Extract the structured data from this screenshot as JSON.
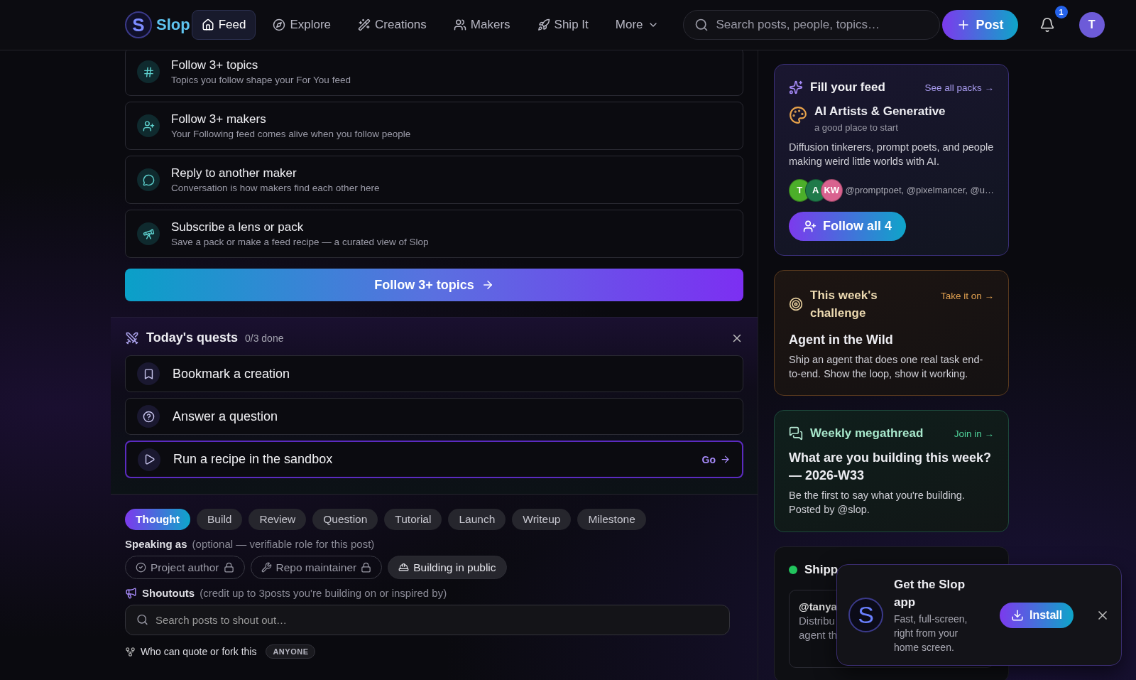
{
  "nav": {
    "logo_letter": "S",
    "logo": "Slop",
    "tabs": [
      {
        "label": "Feed",
        "selected": true
      },
      {
        "label": "Explore",
        "selected": false
      },
      {
        "label": "Creations",
        "selected": false
      },
      {
        "label": "Makers",
        "selected": false
      },
      {
        "label": "Ship It",
        "selected": false
      }
    ],
    "more": "More",
    "search": {
      "placeholder": "Search posts, people, topics…"
    },
    "post_button": "Post",
    "notifications": "1",
    "avatar": "T"
  },
  "steps": [
    {
      "title": "Follow 3+ topics",
      "subtitle": "Topics you follow shape your For You feed"
    },
    {
      "title": "Follow 3+ makers",
      "subtitle": "Your Following feed comes alive when you follow people"
    },
    {
      "title": "Reply to another maker",
      "subtitle": "Conversation is how makers find each other here"
    },
    {
      "title": "Subscribe a lens or pack",
      "subtitle": "Save a pack or make a feed recipe — a curated view of Slop"
    }
  ],
  "cta": "Follow 3+ topics",
  "quests": {
    "title": "Today's quests",
    "progress": "0/3 done",
    "items": [
      {
        "label": "Bookmark a creation",
        "active": false
      },
      {
        "label": "Answer a question",
        "active": false
      },
      {
        "label": "Run a recipe in the sandbox",
        "active": true,
        "action": "Go"
      }
    ]
  },
  "composer": {
    "post_types": [
      {
        "label": "Thought",
        "selected": true
      },
      {
        "label": "Build",
        "selected": false
      },
      {
        "label": "Review",
        "selected": false
      },
      {
        "label": "Question",
        "selected": false
      },
      {
        "label": "Tutorial",
        "selected": false
      },
      {
        "label": "Launch",
        "selected": false
      },
      {
        "label": "Writeup",
        "selected": false
      },
      {
        "label": "Milestone",
        "selected": false
      }
    ],
    "speaking_as": {
      "label": "Speaking as",
      "hint": "(optional — verifiable role for this post)",
      "roles": [
        {
          "label": "Project author",
          "locked": true,
          "selected": false
        },
        {
          "label": "Repo maintainer",
          "locked": true,
          "selected": false
        },
        {
          "label": "Building in public",
          "locked": false,
          "selected": true
        }
      ]
    },
    "shoutouts": {
      "label": "Shoutouts",
      "hint": "(credit up to 3posts you're building on or inspired by)",
      "placeholder": "Search posts to shout out…"
    },
    "quote": {
      "label": "Who can quote or fork this",
      "value": "ANYONE"
    }
  },
  "sidebar": {
    "feed": {
      "title": "Fill your feed",
      "link": "See all packs →",
      "pack": "AI Artists & Generative",
      "pack_note": "a good place to start",
      "description": "Diffusion tinkerers, prompt poets, and people making weird little worlds with AI.",
      "avatars": [
        {
          "initials": "T",
          "color": "#4caf2a"
        },
        {
          "initials": "A",
          "color": "#1f7a4a"
        },
        {
          "initials": "KW",
          "color": "#d9628f"
        }
      ],
      "members": "@promptpoet, @pixelmancer, @u…",
      "button": "Follow all 4"
    },
    "challenge": {
      "title": "This week's challenge",
      "link": "Take it on →",
      "name": "Agent in the Wild",
      "description": "Ship an agent that does one real task end-to-end. Show the loop, show it working."
    },
    "megathread": {
      "title": "Weekly megathread",
      "link": "Join in →",
      "name": "What are you building this week? — 2026-W33",
      "description": "Be the first to say what you're building. Posted by @slop."
    },
    "shipping": {
      "title": "Shipp",
      "item": {
        "handle": "@tanya",
        "lines": [
          "Distribu",
          "agent th"
        ]
      }
    }
  },
  "toast": {
    "logo_letter": "S",
    "title": "Get the Slop app",
    "body": "Fast, full-screen, right from your home screen.",
    "button": "Install"
  }
}
